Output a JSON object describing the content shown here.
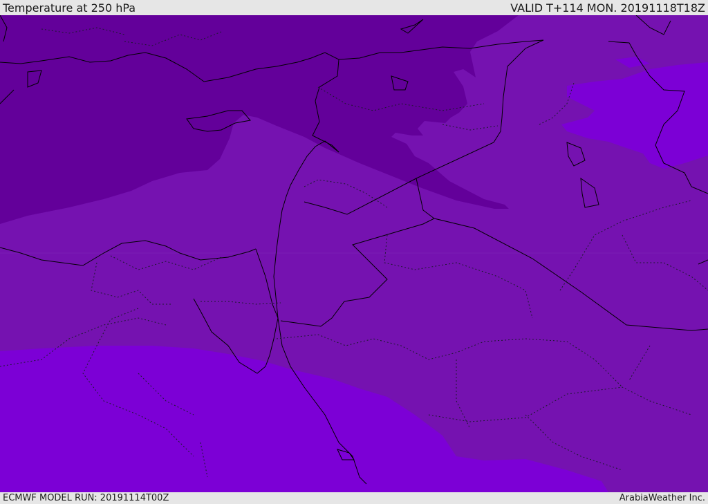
{
  "header": {
    "title": "Temperature at 250 hPa",
    "valid_time": "VALID T+114 MON. 20191118T18Z"
  },
  "footer": {
    "model_run": "ECMWF MODEL RUN: 20191114T00Z",
    "credit": "ArabiaWeather Inc."
  },
  "map": {
    "field": "temperature",
    "level": "250 hPa",
    "colors": {
      "band_coldest_dark": "#63009a",
      "band_mid": "#7512b0",
      "band_warm_bright": "#7c00d6",
      "coastline": "#000000",
      "border_dotted": "#1a1a2a"
    }
  }
}
